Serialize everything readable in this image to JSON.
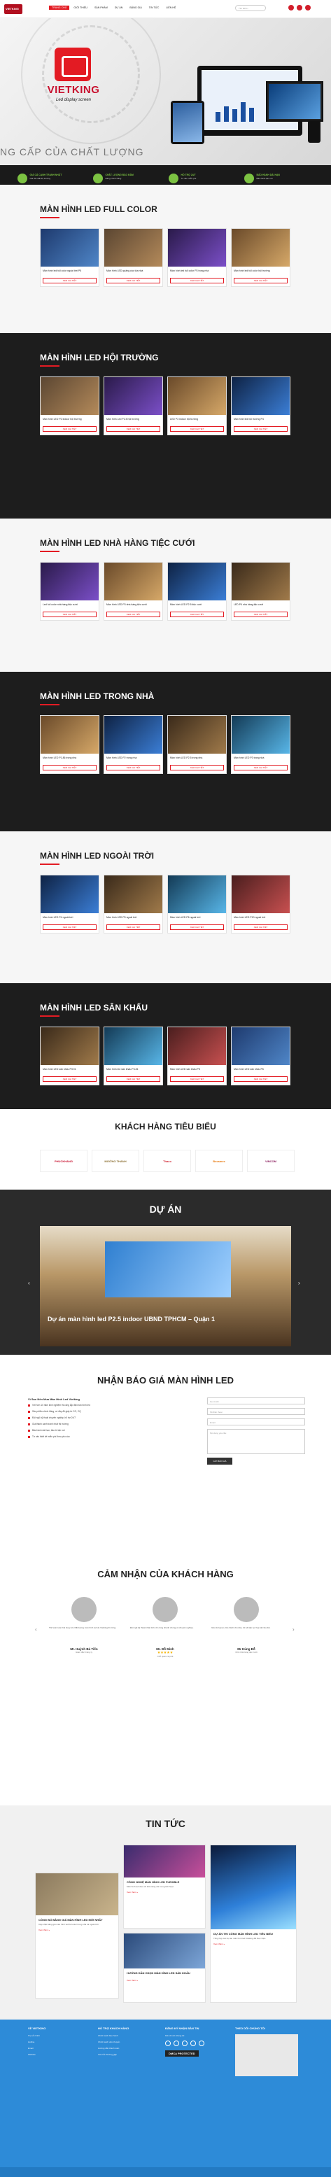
{
  "header": {
    "logo_text": "VIETKING",
    "nav": [
      "TRANG CHỦ",
      "GIỚI THIỆU",
      "SẢN PHẨM",
      "DỰ ÁN",
      "BẢNG GIÁ",
      "TIN TỨC",
      "LIÊN HỆ"
    ],
    "search_placeholder": "Tìm kiếm..."
  },
  "hero": {
    "brand": "VIETKING",
    "brand_sub": "Led display screen",
    "tagline": "NG CẤP CỦA CHẤT LƯỢNG",
    "features": [
      {
        "title": "GIÁ CẢ CẠNH TRANH NHẤT",
        "desc": "Giá tốt nhất thị trường"
      },
      {
        "title": "CHẤT LƯỢNG BẢO ĐẢM",
        "desc": "Hàng chính hãng"
      },
      {
        "title": "HỖ TRỢ 24/7",
        "desc": "Tư vấn miễn phí"
      },
      {
        "title": "BẢO HÀNH DÀI HẠN",
        "desc": "Bảo hành tận nơi"
      }
    ]
  },
  "sections": [
    {
      "title": "MÀN HÌNH LED FULL COLOR",
      "theme": "light",
      "items": [
        "Màn hình led full color ngoài trời P5",
        "Màn hình LED quảng cáo tòa nhà",
        "Màn hình led full color P3 trong nhà",
        "Màn hình led full color hội trường"
      ]
    },
    {
      "title": "MÀN HÌNH LED HỘI TRƯỜNG",
      "theme": "dark",
      "items": [
        "Màn hình LED P2 indoor hội trường",
        "Màn hình Led P2.5 hội trường",
        "LED P3 indoor hội trường",
        "Màn hình led hội trường P4"
      ]
    },
    {
      "title": "MÀN HÌNH LED NHÀ HÀNG TIỆC CƯỚI",
      "theme": "light",
      "items": [
        "Led full color nhà hàng tiệc cưới",
        "Màn hình LED P3 nhà hàng tiệc cưới",
        "Màn hình LED P2.5 tiệc cưới",
        "LED P4 nhà hàng tiệc cưới"
      ]
    },
    {
      "title": "MÀN HÌNH LED TRONG NHÀ",
      "theme": "dark",
      "items": [
        "Màn hình LED P1.86 trong nhà",
        "Màn hình LED P2 trong nhà",
        "Màn hình LED P2.5 trong nhà",
        "Màn hình LED P3 trong nhà"
      ]
    },
    {
      "title": "MÀN HÌNH LED NGOÀI TRỜI",
      "theme": "light",
      "items": [
        "Màn hình LED P4 ngoài trời",
        "Màn hình LED P5 ngoài trời",
        "Màn hình LED P6 ngoài trời",
        "Màn hình LED P10 ngoài trời"
      ]
    },
    {
      "title": "MÀN HÌNH LED SÂN KHẤU",
      "theme": "dark",
      "items": [
        "Màn hình LED sân khấu P3.91",
        "Màn hình led sân khấu P4.81",
        "Màn hình LED sân khấu P5",
        "Màn hình LED sân khấu P6"
      ]
    }
  ],
  "card_cta": "XEM CHI TIẾT",
  "clients": {
    "title": "KHÁCH HÀNG TIÊU BIỂU",
    "logos": [
      "PHUCKHANG",
      "MƯỜNG THANH",
      "Thaco",
      "Becamex",
      "VINCOM"
    ]
  },
  "project": {
    "title": "DỰ ÁN",
    "caption": "Dự án màn hình led P2.5 indoor UBND TPHCM – Quận 1"
  },
  "quote": {
    "title": "NHẬN BÁO GIÁ MÀN HÌNH LED",
    "lead": "Vì Sao Nên Mua Màn Hình Led Vietking",
    "points": [
      "Với hơn 10 năm kinh nghiệm thi công lắp đặt màn hình led",
      "Sản phẩm chính hãng, có đầy đủ giấy tờ CO, CQ",
      "Đội ngũ kỹ thuật chuyên nghiệp, hỗ trợ 24/7",
      "Giá thành cạnh tranh nhất thị trường",
      "Bảo hành dài hạn, bảo trì tận nơi",
      "Tư vấn thiết kế miễn phí theo yêu cầu"
    ],
    "fields": [
      "Họ và tên",
      "Số điện thoại",
      "Email"
    ],
    "message_placeholder": "Nội dung yêu cầu",
    "submit": "GỬI BÁO GIÁ"
  },
  "testimonials": {
    "title": "CẢM NHẬN CỦA KHÁCH HÀNG",
    "items": [
      {
        "quote": "Tôi hoàn toàn hài lòng với chất lượng màn hình led do Vietking thi công.",
        "name": "Mr. Huỳnh Bá Tiến",
        "role": "Giám đốc Công ty"
      },
      {
        "quote": "Đội ngũ kỹ thuật nhiệt tình, thi công nhanh chóng và chuyên nghiệp.",
        "name": "Mr. Đỗ Minh",
        "role": "Chủ quán cà phê"
      },
      {
        "quote": "Giá cả hợp lý, bảo hành chu đáo, tôi sẽ tiếp tục hợp tác lâu dài.",
        "name": "Mr Hùng Đỗ",
        "role": "Chủ nhà hàng tiệc cưới"
      }
    ]
  },
  "news": {
    "title": "TIN TỨC",
    "items": [
      {
        "title": "CÔNG BỐ BẢNG GIÁ MÀN HÌNH LED MỚI NHẤT",
        "desc": "Cập nhật bảng giá màn hình led full color trong nhà và ngoài trời."
      },
      {
        "title": "CÔNG NGHỆ MÀN HÌNH LED FLEXIBLE",
        "desc": "Màn hình led dẻo với khả năng uốn cong linh hoạt."
      },
      {
        "title": "HƯỚNG DẪN CHỌN MÀN HÌNH LED SÂN KHẤU",
        "desc": "Những lưu ý quan trọng khi lựa chọn màn hình led."
      },
      {
        "title": "DỰ ÁN THI CÔNG MÀN HÌNH LED TIÊU BIỂU",
        "desc": "Tổng hợp các dự án màn hình led Vietking đã thực hiện."
      }
    ],
    "more": "Xem thêm »"
  },
  "footer": {
    "cols": [
      {
        "head": "VỀ VIETKING",
        "links": [
          "Trụ sở chính",
          "Hotline",
          "Email",
          "Website"
        ]
      },
      {
        "head": "HỖ TRỢ KHÁCH HÀNG",
        "links": [
          "Chính sách bảo hành",
          "Chính sách vận chuyển",
          "Hướng dẫn thanh toán",
          "Câu hỏi thường gặp"
        ]
      },
      {
        "head": "ĐĂNG KÝ NHẬN BẢN TIN",
        "links": [
          "Kết nối với chúng tôi"
        ]
      },
      {
        "head": "THEO DÕI CHÚNG TÔI",
        "links": []
      }
    ],
    "dmca": "DMCA PROTECTED"
  },
  "colors": {
    "brand": "#e31b23",
    "accent": "#7cc242",
    "footer": "#2d8bd8"
  }
}
